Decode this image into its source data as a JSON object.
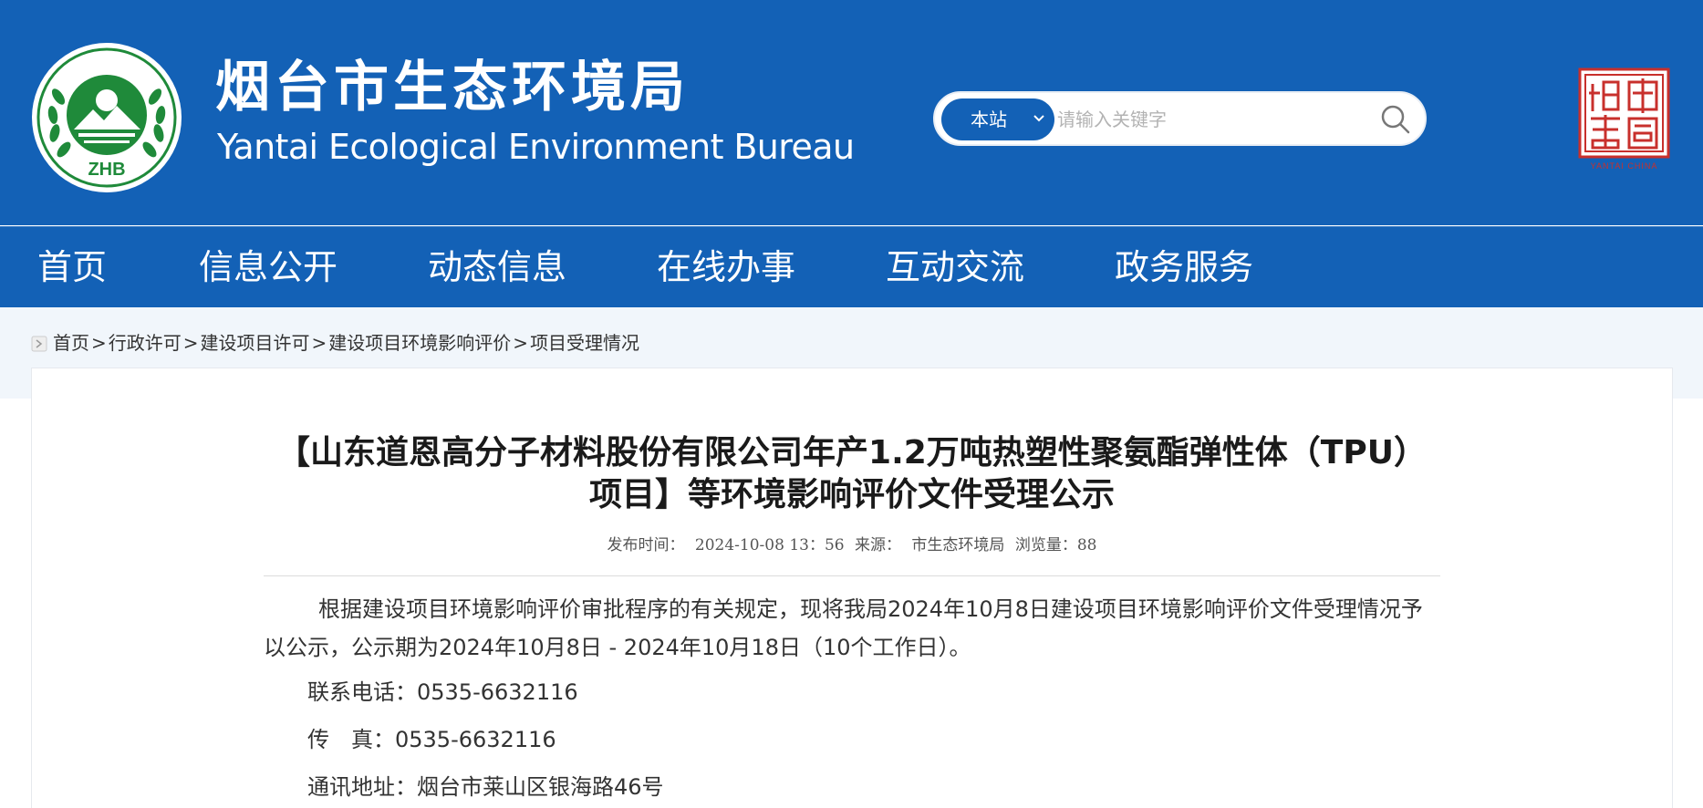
{
  "header": {
    "title_cn": "烟台市生态环境局",
    "title_en": "Yantai Ecological Environment Bureau",
    "logo_text": "ZHB",
    "seal_text": "YANTAI CHINA",
    "colors": {
      "primary": "#1361b6",
      "logo_green": "#1f8a3a"
    }
  },
  "search": {
    "scope": "本站",
    "placeholder": "请输入关键字",
    "button_icon": "search-icon"
  },
  "nav": {
    "items": [
      {
        "label": "首页"
      },
      {
        "label": "信息公开"
      },
      {
        "label": "动态信息"
      },
      {
        "label": "在线办事"
      },
      {
        "label": "互动交流"
      },
      {
        "label": "政务服务"
      }
    ]
  },
  "breadcrumb": {
    "items": [
      "首页",
      "行政许可",
      "建设项目许可",
      "建设项目环境影响评价",
      "项目受理情况"
    ],
    "separator": ">"
  },
  "article": {
    "title": "【山东道恩高分子材料股份有限公司年产1.2万吨热塑性聚氨酯弹性体（TPU）项目】等环境影响评价文件受理公示",
    "meta": {
      "date_label": "发布时间：",
      "date": "2024-10-08 13：56",
      "source_label": "来源：",
      "source": "市生态环境局",
      "views_label": "浏览量：",
      "views": "88"
    },
    "paragraph": "根据建设项目环境影响评价审批程序的有关规定，现将我局2024年10月8日建设项目环境影响评价文件受理情况予以公示，公示期为2024年10月8日 - 2024年10月18日（10个工作日）。",
    "contacts": [
      {
        "label": "联系电话：",
        "value": "0535-6632116"
      },
      {
        "label": "传　真：",
        "value": "0535-6632116"
      },
      {
        "label": "通讯地址：",
        "value": "烟台市莱山区银海路46号"
      }
    ]
  }
}
